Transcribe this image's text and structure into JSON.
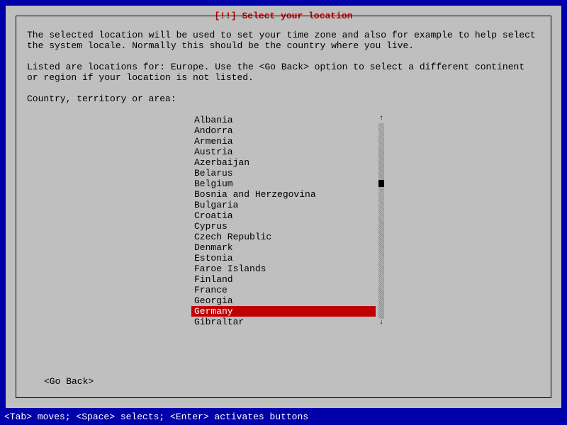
{
  "title": "[!!] Select your location",
  "description_line1": "The selected location will be used to set your time zone and also for example to help select the system locale. Normally this should be the country where you live.",
  "description_line2": "Listed are locations for: Europe. Use the <Go Back> option to select a different continent or region if your location is not listed.",
  "prompt": "Country, territory or area:",
  "list": {
    "items": [
      "Albania",
      "Andorra",
      "Armenia",
      "Austria",
      "Azerbaijan",
      "Belarus",
      "Belgium",
      "Bosnia and Herzegovina",
      "Bulgaria",
      "Croatia",
      "Cyprus",
      "Czech Republic",
      "Denmark",
      "Estonia",
      "Faroe Islands",
      "Finland",
      "France",
      "Georgia",
      "Germany",
      "Gibraltar"
    ],
    "selected_index": 18
  },
  "scroll": {
    "up_arrow": "↑",
    "down_arrow": "↓",
    "thumb_percent": 30
  },
  "go_back_label": "<Go Back>",
  "status_text": "<Tab> moves; <Space> selects; <Enter> activates buttons"
}
